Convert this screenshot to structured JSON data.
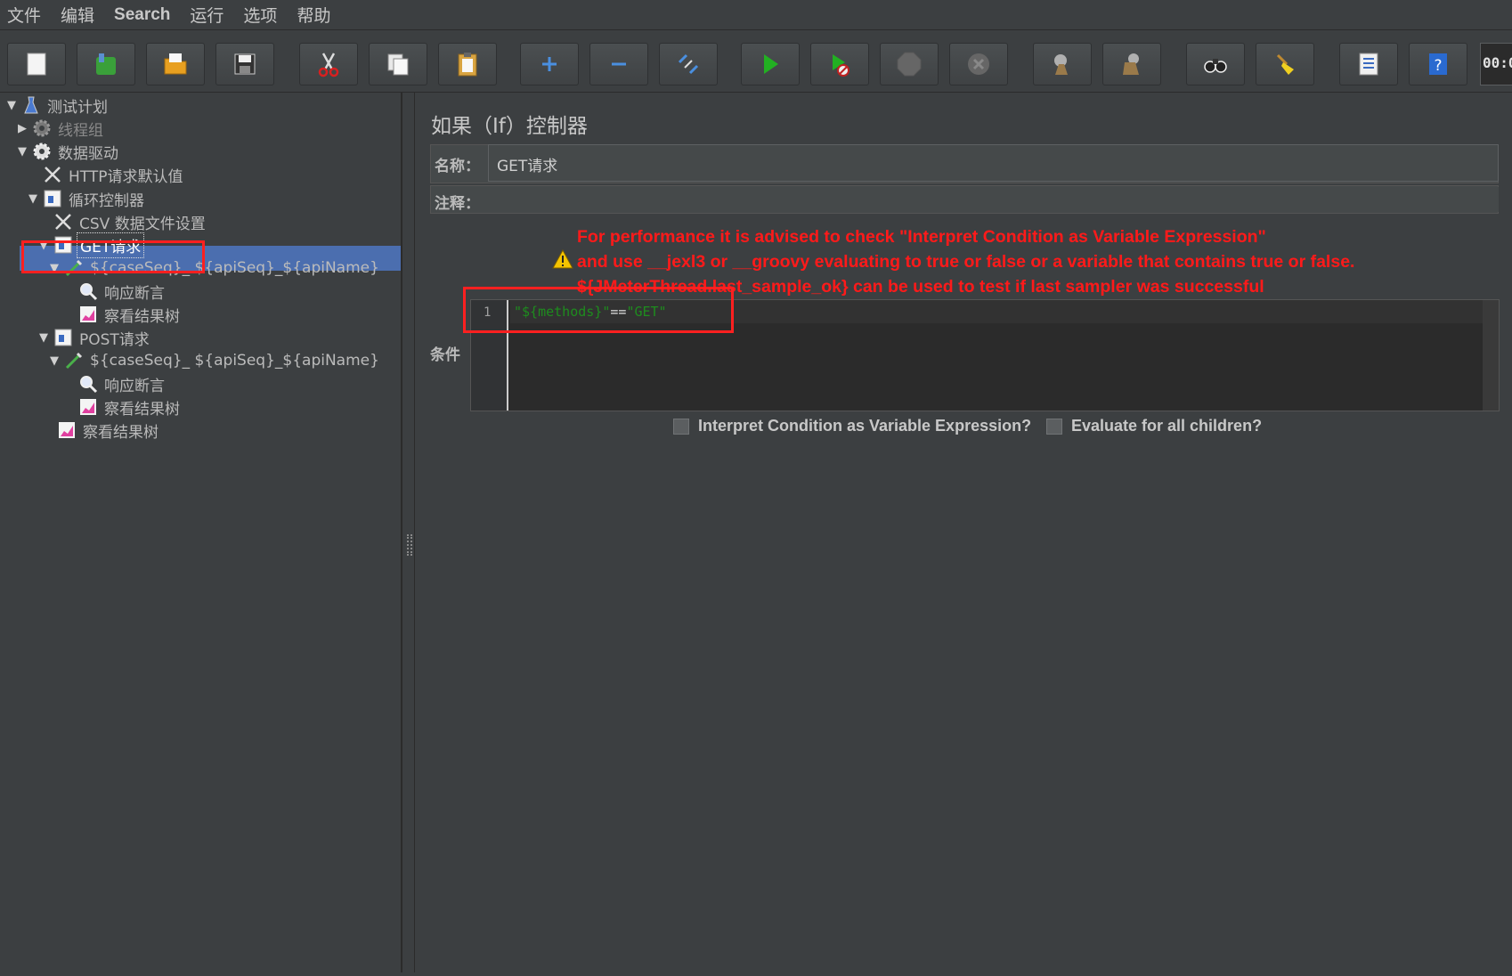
{
  "menu": [
    "文件",
    "编辑",
    "Search",
    "运行",
    "选项",
    "帮助"
  ],
  "toolbar": {
    "buttons": [
      "new-icon",
      "templates-icon",
      "open-icon",
      "save-icon",
      "cut-icon",
      "copy-icon",
      "paste-icon",
      "expand-icon",
      "collapse-icon",
      "toggle-icon",
      "start-icon",
      "start-no-pause-icon",
      "stop-icon",
      "shutdown-icon",
      "clear-icon",
      "clear-all-icon",
      "search-icon",
      "reset-search-icon",
      "function-helper-icon",
      "help-icon"
    ],
    "timer": "00:0"
  },
  "tree": [
    {
      "label": "测试计划",
      "icon": "flask-icon",
      "toggle": "▼"
    },
    {
      "label": "线程组",
      "icon": "gear-icon",
      "toggle": "▶"
    },
    {
      "label": "数据驱动",
      "icon": "gear-icon",
      "toggle": "▼"
    },
    {
      "label": "HTTP请求默认值",
      "icon": "wrench-icon",
      "toggle": ""
    },
    {
      "label": "循环控制器",
      "icon": "controller-icon",
      "toggle": "▼"
    },
    {
      "label": "CSV 数据文件设置",
      "icon": "wrench-icon",
      "toggle": ""
    },
    {
      "label": "GET请求",
      "icon": "controller-icon",
      "toggle": "▼"
    },
    {
      "label": "${caseSeq}_ ${apiSeq}_${apiName}",
      "icon": "pipette-icon",
      "toggle": "▼"
    },
    {
      "label": "响应断言",
      "icon": "magnifier-icon",
      "toggle": ""
    },
    {
      "label": "察看结果树",
      "icon": "graph-icon",
      "toggle": ""
    },
    {
      "label": "POST请求",
      "icon": "controller-icon",
      "toggle": "▼"
    },
    {
      "label": "${caseSeq}_ ${apiSeq}_${apiName}",
      "icon": "pipette-icon",
      "toggle": "▼"
    },
    {
      "label": "响应断言",
      "icon": "magnifier-icon",
      "toggle": ""
    },
    {
      "label": "察看结果树",
      "icon": "graph-icon",
      "toggle": ""
    },
    {
      "label": "察看结果树",
      "icon": "graph-icon",
      "toggle": ""
    }
  ],
  "panel": {
    "title": "如果（If）控制器",
    "name_label": "名称：",
    "name_value": "GET请求",
    "comment_label": "注释：",
    "warning_line1": "For performance it is advised to check \"Interpret Condition as Variable Expression\"",
    "warning_line2": "and use __jexl3 or __groovy evaluating to true or false or a variable that contains true or false.",
    "warning_line3": "${JMeterThread.last_sample_ok} can be used to test if last sampler was successful",
    "condition_label": "条件",
    "line_number": "1",
    "code_part1": "\"${methods}\"",
    "code_op": "==",
    "code_part2": "\"GET\"",
    "checkbox1_label": "Interpret Condition as Variable Expression?",
    "checkbox2_label": "Evaluate for all children?"
  },
  "colors": {
    "background": "#3c3f41",
    "selection": "#4b6eaf",
    "warning": "#ff1a1a",
    "code_string": "#1e8c1e",
    "annotation_box": "#ff2020"
  }
}
